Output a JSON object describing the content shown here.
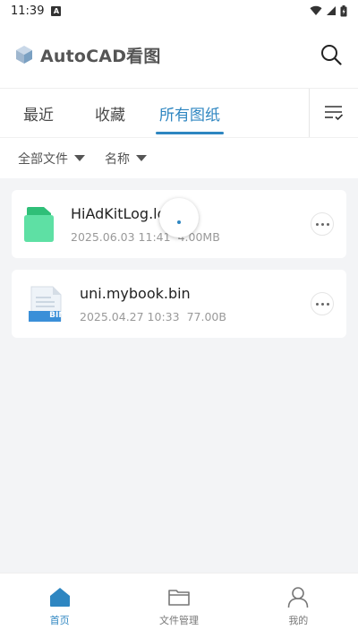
{
  "status_bar": {
    "time": "11:39",
    "notification_icon": "A"
  },
  "app": {
    "title": "AutoCAD看图"
  },
  "tabs": [
    {
      "label": "最近",
      "active": false
    },
    {
      "label": "收藏",
      "active": false
    },
    {
      "label": "所有图纸",
      "active": true
    }
  ],
  "filters": [
    {
      "label": "全部文件"
    },
    {
      "label": "名称"
    }
  ],
  "files": [
    {
      "name": "HiAdKitLog.log",
      "date": "2025.06.03 11:41",
      "size": "4.00MB",
      "icon": "log-file-icon"
    },
    {
      "name": "uni.mybook.bin",
      "date": "2025.04.27 10:33",
      "size": "77.00B",
      "icon": "bin-file-icon",
      "badge": "BIN"
    }
  ],
  "bottom_nav": [
    {
      "label": "首页",
      "active": true
    },
    {
      "label": "文件管理",
      "active": false
    },
    {
      "label": "我的",
      "active": false
    }
  ],
  "colors": {
    "accent": "#2e86c1",
    "log_icon": "#3ecf8e",
    "bin_badge": "#3a8fd8"
  }
}
